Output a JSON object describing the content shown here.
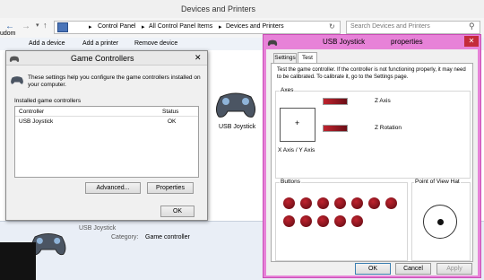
{
  "bg_window": {
    "title": "Devices and Printers",
    "path": [
      "Control Panel",
      "All Control Panel Items",
      "Devices and Printers"
    ],
    "search_placeholder": "Search Devices and Printers",
    "toolbar": [
      "Add a device",
      "Add a printer",
      "Remove device"
    ],
    "device_label": "USB Joystick",
    "left_edge_text": "udom",
    "details": {
      "device_name": "USB Joystick",
      "category_label": "Category:",
      "category_value": "Game controller"
    }
  },
  "game_controllers": {
    "title": "Game Controllers",
    "description": "These settings help you configure the game controllers installed on your computer.",
    "list_label": "Installed game controllers",
    "columns": [
      "Controller",
      "Status"
    ],
    "rows": [
      {
        "controller": "USB Joystick",
        "status": "OK"
      }
    ],
    "buttons": {
      "advanced": "Advanced...",
      "properties": "Properties",
      "ok": "OK"
    },
    "close_glyph": "✕"
  },
  "properties": {
    "title_left": "USB Joystick",
    "title_right": "properties",
    "close_glyph": "✕",
    "tabs": [
      "Settings",
      "Test"
    ],
    "active_tab": "Test",
    "instructions": "Test the game controller.  If the controller is not functioning properly, it may need to be calibrated.  To calibrate it, go to the Settings page.",
    "axes_group": "Axes",
    "xy_label": "X Axis / Y Axis",
    "crosshair": "+",
    "z_axis_label": "Z Axis",
    "z_rotation_label": "Z Rotation",
    "z_axis_value": 0.5,
    "z_rotation_value": 0.5,
    "buttons_group": "Buttons",
    "button_count": 12,
    "pov_group": "Point of View Hat",
    "footer": {
      "ok": "OK",
      "cancel": "Cancel",
      "apply": "Apply"
    }
  },
  "colors": {
    "accent_pink": "#e782d8",
    "button_red": "#9d1424",
    "border_pink": "#e05cc8"
  }
}
